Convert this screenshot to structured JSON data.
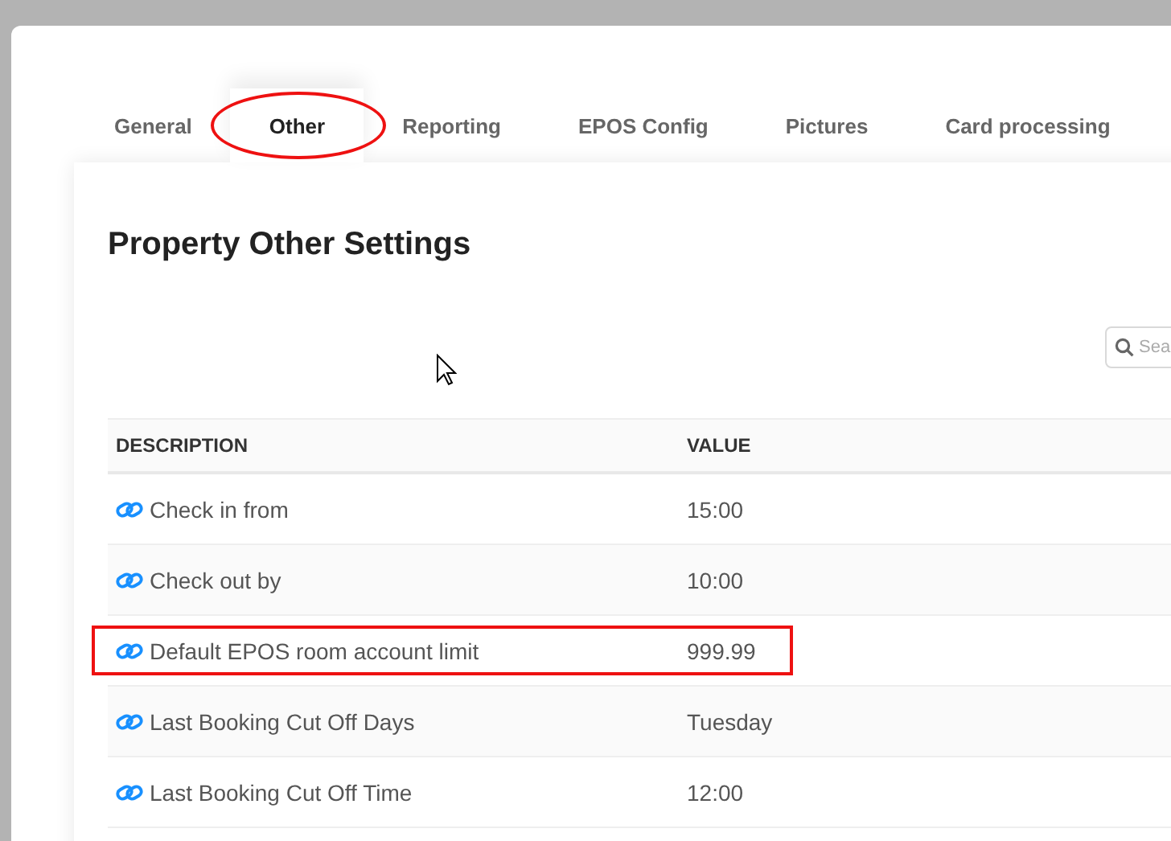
{
  "tabs": [
    {
      "label": "General",
      "selected": false,
      "circled": false
    },
    {
      "label": "Other",
      "selected": true,
      "circled": true
    },
    {
      "label": "Reporting",
      "selected": false,
      "circled": false
    },
    {
      "label": "EPOS Config",
      "selected": false,
      "circled": false
    },
    {
      "label": "Pictures",
      "selected": false,
      "circled": false
    },
    {
      "label": "Card processing",
      "selected": false,
      "circled": false
    }
  ],
  "title": "Property Other Settings",
  "search": {
    "placeholder": "Sea"
  },
  "table": {
    "columns": [
      "DESCRIPTION",
      "VALUE"
    ],
    "rows": [
      {
        "description": "Check in from",
        "value": "15:00",
        "boxed": false
      },
      {
        "description": "Check out by",
        "value": "10:00",
        "boxed": false
      },
      {
        "description": "Default EPOS room account limit",
        "value": "999.99",
        "boxed": true
      },
      {
        "description": "Last Booking Cut Off Days",
        "value": "Tuesday",
        "boxed": false
      },
      {
        "description": "Last Booking Cut Off Time",
        "value": "12:00",
        "boxed": false
      }
    ]
  }
}
